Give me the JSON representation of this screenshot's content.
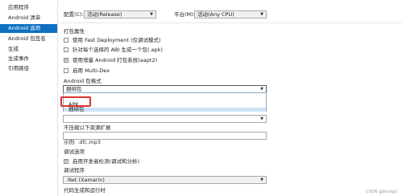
{
  "sidebar": {
    "items": [
      {
        "label": "应用程序",
        "active": false
      },
      {
        "label": "Android 清单",
        "active": false
      },
      {
        "label": "Android 选项",
        "active": true
      },
      {
        "label": "Android 包签名",
        "active": false
      },
      {
        "label": "生成",
        "active": false
      },
      {
        "label": "生成事件",
        "active": false
      },
      {
        "label": "引用路径",
        "active": false
      }
    ]
  },
  "topbar": {
    "config_label": "配置(C):",
    "config_value": "活动(Release)",
    "platform_label": "平台(M):",
    "platform_value": "活动(Any CPU)"
  },
  "packaging": {
    "title": "打包属性",
    "options": [
      {
        "label": "使用 Fast Deployment (仅调试模式)",
        "checked": false
      },
      {
        "label": "针对每个选择的 ABI 生成一个包(.apk)",
        "checked": false
      },
      {
        "label": "使用增量 Android 打包系统(aapt2)",
        "checked": true
      },
      {
        "label": "启用 Multi-Dex",
        "checked": false
      }
    ],
    "format_label": "Android 包格式",
    "format_value": "捆绑包",
    "format_options": [
      "APK",
      "捆绑包"
    ],
    "no_compress_label": "不压缩以下资源扩展",
    "no_compress_hint": "示例: .dll;.mp3"
  },
  "debugging": {
    "title": "调试选项",
    "enable_debug_label": "启用开发者检测(调试和分析)",
    "enable_debug_checked": true,
    "debugger_label": "调试程序",
    "debugger_value": ".Net (Xamarin)"
  },
  "codegen": {
    "title": "代码生成和运行时"
  },
  "watermark": "CSDN @bruitgu",
  "colors": {
    "accent": "#0e70c0",
    "highlight": "#cce3f7",
    "callout": "#d9342b"
  }
}
